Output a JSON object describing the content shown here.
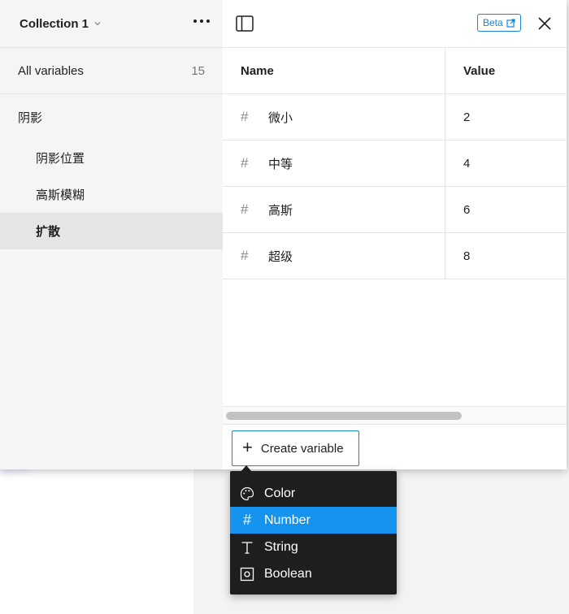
{
  "sidebar": {
    "collection_name": "Collection 1",
    "all_variables_label": "All variables",
    "all_variables_count": "15",
    "group_label": "阴影",
    "subgroups": [
      {
        "label": "阴影位置"
      },
      {
        "label": "高斯模糊"
      },
      {
        "label": "扩散"
      }
    ]
  },
  "toolbar": {
    "beta_label": "Beta"
  },
  "table": {
    "headers": {
      "name": "Name",
      "value": "Value"
    },
    "rows": [
      {
        "name": "微小",
        "value": "2"
      },
      {
        "name": "中等",
        "value": "4"
      },
      {
        "name": "高斯",
        "value": "6"
      },
      {
        "name": "超级",
        "value": "8"
      }
    ],
    "type_symbol": "#"
  },
  "footer": {
    "create_label": "Create variable"
  },
  "type_menu": {
    "items": [
      {
        "label": "Color",
        "icon": "palette-icon"
      },
      {
        "label": "Number",
        "icon": "hash-icon"
      },
      {
        "label": "String",
        "icon": "text-icon"
      },
      {
        "label": "Boolean",
        "icon": "toggle-icon"
      }
    ],
    "selected": "Number"
  },
  "colors": {
    "accent": "#1a84d8",
    "menu_bg": "#1e1e1e",
    "menu_selected": "#1594ef"
  }
}
